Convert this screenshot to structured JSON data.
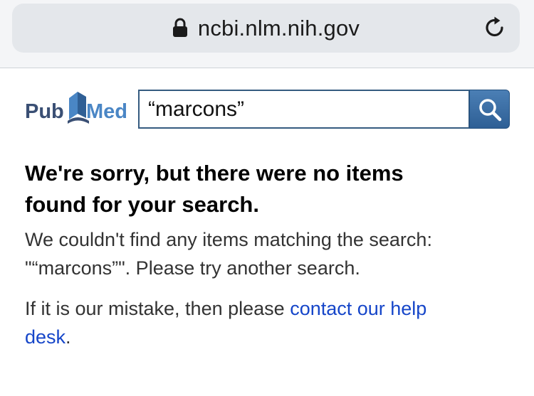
{
  "browser": {
    "url": "ncbi.nlm.nih.gov",
    "icons": {
      "lock": "lock-icon",
      "reload": "reload-icon"
    }
  },
  "header": {
    "logo": {
      "text_pub": "Pub",
      "text_med": "Med",
      "colors": {
        "dark_blue": "#3a4f74",
        "light_blue": "#4a86c5"
      }
    },
    "search": {
      "value": "“marcons”",
      "button_icon": "magnifier-icon"
    }
  },
  "message": {
    "title_line1": "We're sorry, but there were no items",
    "title_line2": "found for your search.",
    "body_line1": "We couldn't find any items matching the search:",
    "body_line2": "\"“marcons”\". Please try another search.",
    "help_prefix": "If it is our mistake, then please ",
    "help_link_part1": "contact our help",
    "help_link_part2": "desk",
    "help_suffix": "."
  },
  "colors": {
    "link": "#1646c9",
    "search_border": "#355b80",
    "search_button": "#3a6ea6"
  }
}
